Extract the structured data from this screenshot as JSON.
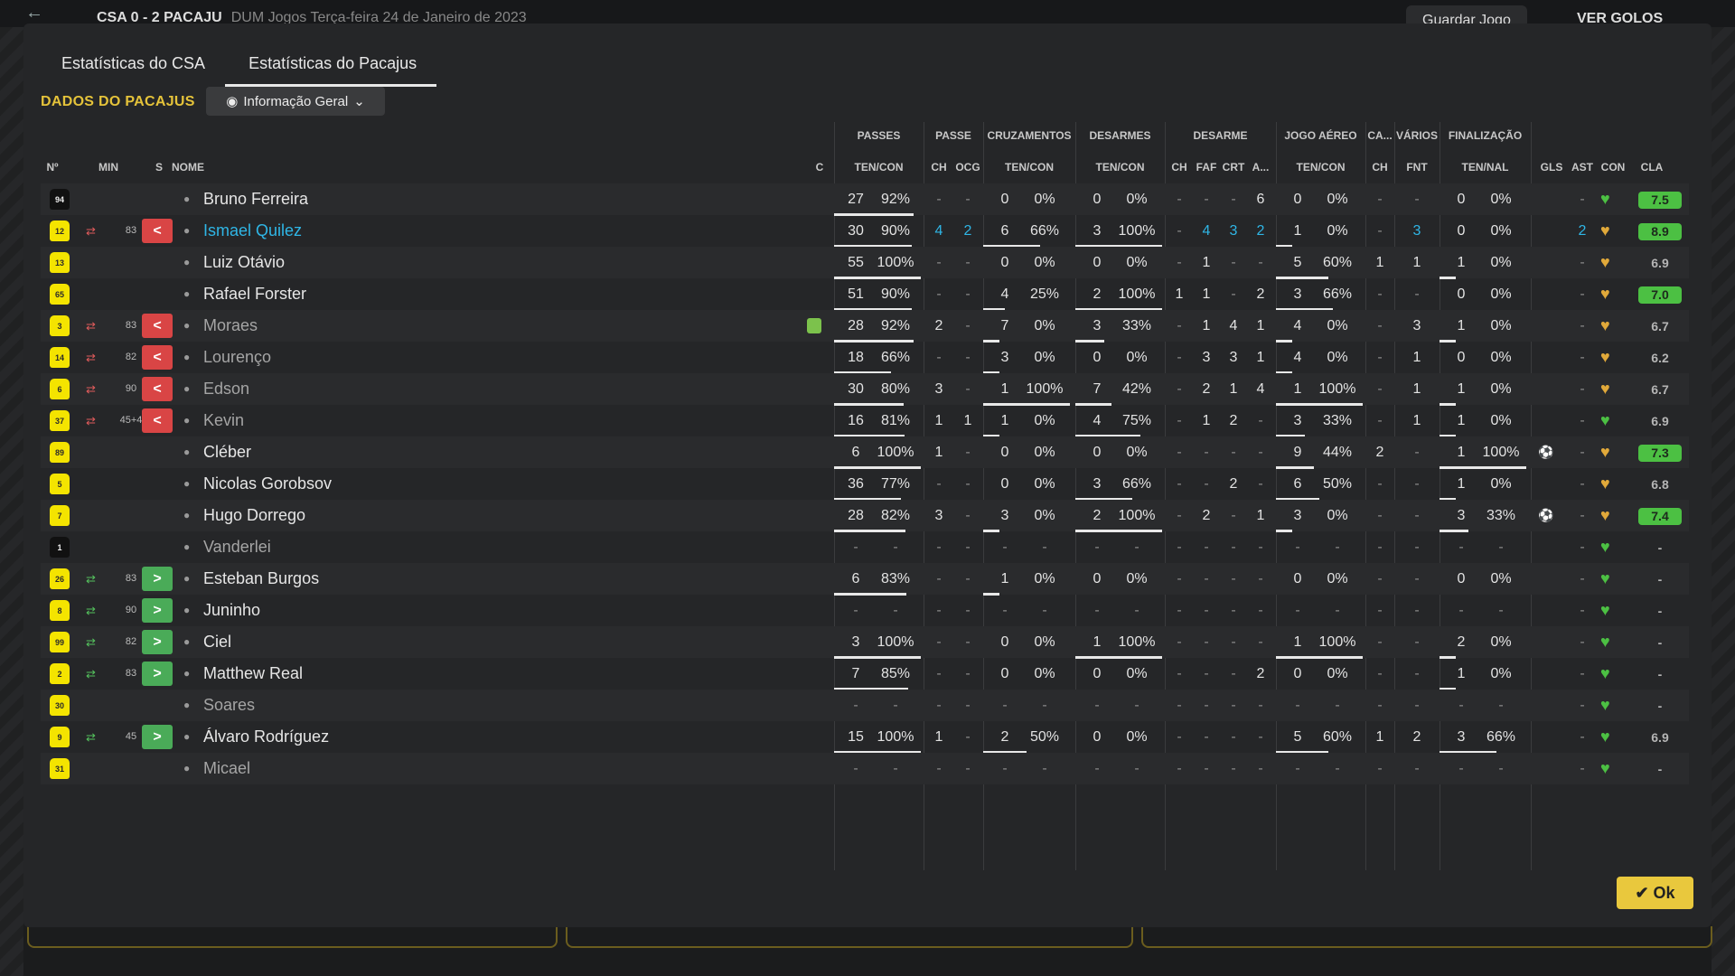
{
  "topbar": {
    "title": "CSA 0 - 2 PACAJU",
    "subtitle": "DUM Jogos  Terça-feira 24 de Janeiro de 2023",
    "save_label": "Guardar Jogo",
    "goals_label": "VER GOLOS"
  },
  "tabs": [
    "Estatísticas do CSA",
    "Estatísticas do Pacajus"
  ],
  "section_title": "DADOS DO PACAJUS",
  "dropdown": {
    "label": "Informação Geral"
  },
  "groups": [
    "PASSES",
    "PASSE",
    "CRUZAMENTOS",
    "DESARMES",
    "DESARME",
    "JOGO AÉREO",
    "CA...",
    "VÁRIOS",
    "FINALIZAÇÃO"
  ],
  "columns": {
    "num": "Nº",
    "min": "MIN",
    "s": "S",
    "name": "NOME",
    "c": "C",
    "passes": "TEN/CON",
    "ch": "CH",
    "ocg": "OCG",
    "cross": "TEN/CON",
    "tackles": "TEN/CON",
    "d_ch": "CH",
    "faf": "FAF",
    "crt": "CRT",
    "a": "A...",
    "aerial": "TEN/CON",
    "ca_ch": "CH",
    "fnt": "FNT",
    "finish": "TEN/NAL",
    "gls": "GLS",
    "ast": "AST",
    "con": "CON",
    "cla": "CLA"
  },
  "rows": [
    {
      "num": "94",
      "kit": "black",
      "min": "",
      "sub": "",
      "name": "Bruno Ferreira",
      "p": [
        "27",
        "92%"
      ],
      "pb": 0.92,
      "pch": "-",
      "ocg": "-",
      "cr": [
        "0",
        "0%"
      ],
      "crb": 0,
      "ds": [
        "0",
        "0%"
      ],
      "dsb": 0,
      "dch": "-",
      "faf": "-",
      "crt": "-",
      "a": "6",
      "ae": [
        "0",
        "0%"
      ],
      "aeb": 0,
      "cach": "-",
      "fnt": "-",
      "fi": [
        "0",
        "0%"
      ],
      "fib": 0,
      "gls": "",
      "ast": "-",
      "heart": "green",
      "rating": "7.5",
      "rgood": true
    },
    {
      "num": "12",
      "kit": "yellow",
      "min": "83",
      "sub": "out",
      "name": "Ismael Quilez",
      "hl": true,
      "blue": true,
      "p": [
        "30",
        "90%"
      ],
      "pb": 0.9,
      "pch": "4",
      "ocg": "2",
      "cr": [
        "6",
        "66%"
      ],
      "crb": 0.66,
      "ds": [
        "3",
        "100%"
      ],
      "dsb": 1,
      "dch": "-",
      "faf": "4",
      "crt": "3",
      "a": "2",
      "ae": [
        "1",
        "0%"
      ],
      "aeb": 0,
      "cach": "-",
      "fnt": "3",
      "fi": [
        "0",
        "0%"
      ],
      "fib": 0,
      "gls": "",
      "ast": "2",
      "heart": "gold",
      "rating": "8.9",
      "rgood": true
    },
    {
      "num": "13",
      "kit": "yellow",
      "min": "",
      "sub": "",
      "name": "Luiz Otávio",
      "p": [
        "55",
        "100%"
      ],
      "pb": 1,
      "pch": "-",
      "ocg": "-",
      "cr": [
        "0",
        "0%"
      ],
      "crb": 0,
      "ds": [
        "0",
        "0%"
      ],
      "dsb": 0,
      "dch": "-",
      "faf": "1",
      "crt": "-",
      "a": "-",
      "ae": [
        "5",
        "60%"
      ],
      "aeb": 0.6,
      "cach": "1",
      "fnt": "1",
      "fi": [
        "1",
        "0%"
      ],
      "fib": 0,
      "gls": "",
      "ast": "-",
      "heart": "gold",
      "rating": "6.9",
      "rgood": false
    },
    {
      "num": "65",
      "kit": "yellow",
      "min": "",
      "sub": "",
      "name": "Rafael Forster",
      "p": [
        "51",
        "90%"
      ],
      "pb": 0.9,
      "pch": "-",
      "ocg": "-",
      "cr": [
        "4",
        "25%"
      ],
      "crb": 0.25,
      "ds": [
        "2",
        "100%"
      ],
      "dsb": 1,
      "dch": "1",
      "faf": "1",
      "crt": "-",
      "a": "2",
      "ae": [
        "3",
        "66%"
      ],
      "aeb": 0.66,
      "cach": "-",
      "fnt": "-",
      "fi": [
        "0",
        "0%"
      ],
      "fib": 0,
      "gls": "",
      "ast": "-",
      "heart": "gold",
      "rating": "7.0",
      "rgood": true
    },
    {
      "num": "3",
      "kit": "yellow",
      "min": "83",
      "sub": "out",
      "name": "Moraes",
      "dim": true,
      "card": true,
      "p": [
        "28",
        "92%"
      ],
      "pb": 0.92,
      "pch": "2",
      "ocg": "-",
      "cr": [
        "7",
        "0%"
      ],
      "crb": 0,
      "ds": [
        "3",
        "33%"
      ],
      "dsb": 0.33,
      "dch": "-",
      "faf": "1",
      "crt": "4",
      "a": "1",
      "ae": [
        "4",
        "0%"
      ],
      "aeb": 0,
      "cach": "-",
      "fnt": "3",
      "fi": [
        "1",
        "0%"
      ],
      "fib": 0,
      "gls": "",
      "ast": "-",
      "heart": "gold",
      "rating": "6.7",
      "rgood": false
    },
    {
      "num": "14",
      "kit": "yellow",
      "min": "82",
      "sub": "out",
      "name": "Lourenço",
      "dim": true,
      "p": [
        "18",
        "66%"
      ],
      "pb": 0.66,
      "pch": "-",
      "ocg": "-",
      "cr": [
        "3",
        "0%"
      ],
      "crb": 0,
      "ds": [
        "0",
        "0%"
      ],
      "dsb": 0,
      "dch": "-",
      "faf": "3",
      "crt": "3",
      "a": "1",
      "ae": [
        "4",
        "0%"
      ],
      "aeb": 0,
      "cach": "-",
      "fnt": "1",
      "fi": [
        "0",
        "0%"
      ],
      "fib": 0,
      "gls": "",
      "ast": "-",
      "heart": "gold",
      "rating": "6.2",
      "rgood": false
    },
    {
      "num": "6",
      "kit": "yellow",
      "min": "90",
      "sub": "out",
      "name": "Edson",
      "dim": true,
      "p": [
        "30",
        "80%"
      ],
      "pb": 0.8,
      "pch": "3",
      "ocg": "-",
      "cr": [
        "1",
        "100%"
      ],
      "crb": 1,
      "ds": [
        "7",
        "42%"
      ],
      "dsb": 0.42,
      "dch": "-",
      "faf": "2",
      "crt": "1",
      "a": "4",
      "ae": [
        "1",
        "100%"
      ],
      "aeb": 1,
      "cach": "-",
      "fnt": "1",
      "fi": [
        "1",
        "0%"
      ],
      "fib": 0,
      "gls": "",
      "ast": "-",
      "heart": "gold",
      "rating": "6.7",
      "rgood": false
    },
    {
      "num": "37",
      "kit": "yellow",
      "min": "45+4",
      "sub": "out",
      "name": "Kevin",
      "dim": true,
      "p": [
        "16",
        "81%"
      ],
      "pb": 0.81,
      "pch": "1",
      "ocg": "1",
      "cr": [
        "1",
        "0%"
      ],
      "crb": 0,
      "ds": [
        "4",
        "75%"
      ],
      "dsb": 0.75,
      "dch": "-",
      "faf": "1",
      "crt": "2",
      "a": "-",
      "ae": [
        "3",
        "33%"
      ],
      "aeb": 0.33,
      "cach": "-",
      "fnt": "1",
      "fi": [
        "1",
        "0%"
      ],
      "fib": 0,
      "gls": "",
      "ast": "-",
      "heart": "green",
      "rating": "6.9",
      "rgood": false
    },
    {
      "num": "89",
      "kit": "yellow",
      "min": "",
      "sub": "",
      "name": "Cléber",
      "p": [
        "6",
        "100%"
      ],
      "pb": 1,
      "pch": "1",
      "ocg": "-",
      "cr": [
        "0",
        "0%"
      ],
      "crb": 0,
      "ds": [
        "0",
        "0%"
      ],
      "dsb": 0,
      "dch": "-",
      "faf": "-",
      "crt": "-",
      "a": "-",
      "ae": [
        "9",
        "44%"
      ],
      "aeb": 0.44,
      "cach": "2",
      "fnt": "-",
      "fi": [
        "1",
        "100%"
      ],
      "fib": 1,
      "gls": "⚽",
      "ast": "-",
      "heart": "gold",
      "rating": "7.3",
      "rgood": true
    },
    {
      "num": "5",
      "kit": "yellow",
      "min": "",
      "sub": "",
      "name": "Nicolas Gorobsov",
      "p": [
        "36",
        "77%"
      ],
      "pb": 0.77,
      "pch": "-",
      "ocg": "-",
      "cr": [
        "0",
        "0%"
      ],
      "crb": 0,
      "ds": [
        "3",
        "66%"
      ],
      "dsb": 0.66,
      "dch": "-",
      "faf": "-",
      "crt": "2",
      "a": "-",
      "ae": [
        "6",
        "50%"
      ],
      "aeb": 0.5,
      "cach": "-",
      "fnt": "-",
      "fi": [
        "1",
        "0%"
      ],
      "fib": 0,
      "gls": "",
      "ast": "-",
      "heart": "gold",
      "rating": "6.8",
      "rgood": false
    },
    {
      "num": "7",
      "kit": "yellow",
      "min": "",
      "sub": "",
      "name": "Hugo Dorrego",
      "p": [
        "28",
        "82%"
      ],
      "pb": 0.82,
      "pch": "3",
      "ocg": "-",
      "cr": [
        "3",
        "0%"
      ],
      "crb": 0,
      "ds": [
        "2",
        "100%"
      ],
      "dsb": 1,
      "dch": "-",
      "faf": "2",
      "crt": "-",
      "a": "1",
      "ae": [
        "3",
        "0%"
      ],
      "aeb": 0,
      "cach": "-",
      "fnt": "-",
      "fi": [
        "3",
        "33%"
      ],
      "fib": 0.33,
      "gls": "⚽",
      "ast": "-",
      "heart": "gold",
      "rating": "7.4",
      "rgood": true
    },
    {
      "num": "1",
      "kit": "black",
      "min": "",
      "sub": "",
      "name": "Vanderlei",
      "dim": true,
      "p": [
        "-",
        "-"
      ],
      "pb": 0,
      "pch": "-",
      "ocg": "-",
      "cr": [
        "-",
        "-"
      ],
      "crb": 0,
      "ds": [
        "-",
        "-"
      ],
      "dsb": 0,
      "dch": "-",
      "faf": "-",
      "crt": "-",
      "a": "-",
      "ae": [
        "-",
        "-"
      ],
      "aeb": 0,
      "cach": "-",
      "fnt": "-",
      "fi": [
        "-",
        "-"
      ],
      "fib": 0,
      "gls": "",
      "ast": "-",
      "heart": "green",
      "rating": "-",
      "rgood": false
    },
    {
      "num": "26",
      "kit": "yellow",
      "min": "83",
      "sub": "in",
      "name": "Esteban Burgos",
      "p": [
        "6",
        "83%"
      ],
      "pb": 0.83,
      "pch": "-",
      "ocg": "-",
      "cr": [
        "1",
        "0%"
      ],
      "crb": 0,
      "ds": [
        "0",
        "0%"
      ],
      "dsb": 0,
      "dch": "-",
      "faf": "-",
      "crt": "-",
      "a": "-",
      "ae": [
        "0",
        "0%"
      ],
      "aeb": 0,
      "cach": "-",
      "fnt": "-",
      "fi": [
        "0",
        "0%"
      ],
      "fib": 0,
      "gls": "",
      "ast": "-",
      "heart": "green",
      "rating": "-",
      "rgood": false
    },
    {
      "num": "8",
      "kit": "yellow",
      "min": "90",
      "sub": "in",
      "name": "Juninho",
      "p": [
        "-",
        "-"
      ],
      "pb": 0,
      "pch": "-",
      "ocg": "-",
      "cr": [
        "-",
        "-"
      ],
      "crb": 0,
      "ds": [
        "-",
        "-"
      ],
      "dsb": 0,
      "dch": "-",
      "faf": "-",
      "crt": "-",
      "a": "-",
      "ae": [
        "-",
        "-"
      ],
      "aeb": 0,
      "cach": "-",
      "fnt": "-",
      "fi": [
        "-",
        "-"
      ],
      "fib": 0,
      "gls": "",
      "ast": "-",
      "heart": "green",
      "rating": "-",
      "rgood": false
    },
    {
      "num": "99",
      "kit": "yellow",
      "min": "82",
      "sub": "in",
      "name": "Ciel",
      "p": [
        "3",
        "100%"
      ],
      "pb": 1,
      "pch": "-",
      "ocg": "-",
      "cr": [
        "0",
        "0%"
      ],
      "crb": 0,
      "ds": [
        "1",
        "100%"
      ],
      "dsb": 1,
      "dch": "-",
      "faf": "-",
      "crt": "-",
      "a": "-",
      "ae": [
        "1",
        "100%"
      ],
      "aeb": 1,
      "cach": "-",
      "fnt": "-",
      "fi": [
        "2",
        "0%"
      ],
      "fib": 0,
      "gls": "",
      "ast": "-",
      "heart": "green",
      "rating": "-",
      "rgood": false
    },
    {
      "num": "2",
      "kit": "yellow",
      "min": "83",
      "sub": "in",
      "name": "Matthew Real",
      "p": [
        "7",
        "85%"
      ],
      "pb": 0.85,
      "pch": "-",
      "ocg": "-",
      "cr": [
        "0",
        "0%"
      ],
      "crb": 0,
      "ds": [
        "0",
        "0%"
      ],
      "dsb": 0,
      "dch": "-",
      "faf": "-",
      "crt": "-",
      "a": "2",
      "ae": [
        "0",
        "0%"
      ],
      "aeb": 0,
      "cach": "-",
      "fnt": "-",
      "fi": [
        "1",
        "0%"
      ],
      "fib": 0,
      "gls": "",
      "ast": "-",
      "heart": "green",
      "rating": "-",
      "rgood": false
    },
    {
      "num": "30",
      "kit": "yellow",
      "min": "",
      "sub": "",
      "name": "Soares",
      "dim": true,
      "p": [
        "-",
        "-"
      ],
      "pb": 0,
      "pch": "-",
      "ocg": "-",
      "cr": [
        "-",
        "-"
      ],
      "crb": 0,
      "ds": [
        "-",
        "-"
      ],
      "dsb": 0,
      "dch": "-",
      "faf": "-",
      "crt": "-",
      "a": "-",
      "ae": [
        "-",
        "-"
      ],
      "aeb": 0,
      "cach": "-",
      "fnt": "-",
      "fi": [
        "-",
        "-"
      ],
      "fib": 0,
      "gls": "",
      "ast": "-",
      "heart": "green",
      "rating": "-",
      "rgood": false
    },
    {
      "num": "9",
      "kit": "yellow",
      "min": "45",
      "sub": "in",
      "name": "Álvaro Rodríguez",
      "p": [
        "15",
        "100%"
      ],
      "pb": 1,
      "pch": "1",
      "ocg": "-",
      "cr": [
        "2",
        "50%"
      ],
      "crb": 0.5,
      "ds": [
        "0",
        "0%"
      ],
      "dsb": 0,
      "dch": "-",
      "faf": "-",
      "crt": "-",
      "a": "-",
      "ae": [
        "5",
        "60%"
      ],
      "aeb": 0.6,
      "cach": "1",
      "fnt": "2",
      "fi": [
        "3",
        "66%"
      ],
      "fib": 0.66,
      "gls": "",
      "ast": "-",
      "heart": "green",
      "rating": "6.9",
      "rgood": false
    },
    {
      "num": "31",
      "kit": "yellow",
      "min": "",
      "sub": "",
      "name": "Micael",
      "dim": true,
      "p": [
        "-",
        "-"
      ],
      "pb": 0,
      "pch": "-",
      "ocg": "-",
      "cr": [
        "-",
        "-"
      ],
      "crb": 0,
      "ds": [
        "-",
        "-"
      ],
      "dsb": 0,
      "dch": "-",
      "faf": "-",
      "crt": "-",
      "a": "-",
      "ae": [
        "-",
        "-"
      ],
      "aeb": 0,
      "cach": "-",
      "fnt": "-",
      "fi": [
        "-",
        "-"
      ],
      "fib": 0,
      "gls": "",
      "ast": "-",
      "heart": "green",
      "rating": "-",
      "rgood": false
    }
  ],
  "ok_label": "Ok",
  "colors": {
    "accent": "#e9c83d",
    "highlight": "#2fb6e6",
    "good_rating": "#4cc043",
    "out": "#d94545",
    "in": "#4aab58"
  }
}
